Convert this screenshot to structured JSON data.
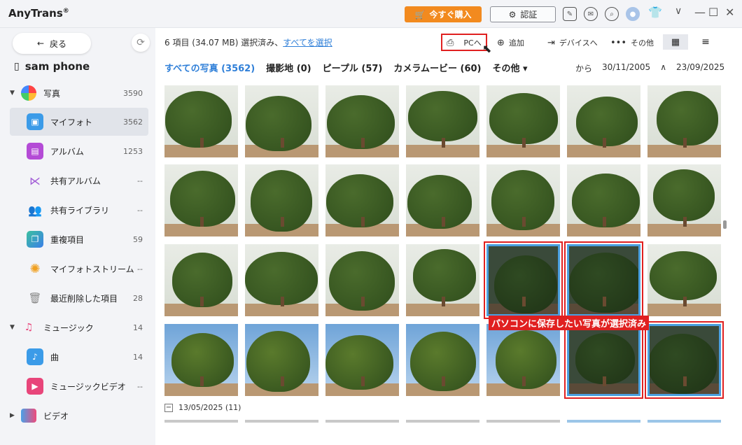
{
  "app": {
    "title": "AnyTrans",
    "reg": "®"
  },
  "titlebar": {
    "buy": "今すぐ購入",
    "auth": "認証"
  },
  "sidebar": {
    "back": "戻る",
    "device": "sam phone",
    "photos_group": {
      "label": "写真",
      "count": "3590"
    },
    "items": [
      {
        "label": "マイフォト",
        "count": "3562"
      },
      {
        "label": "アルバム",
        "count": "1253"
      },
      {
        "label": "共有アルバム",
        "count": "--"
      },
      {
        "label": "共有ライブラリ",
        "count": "--"
      },
      {
        "label": "重複項目",
        "count": "59"
      },
      {
        "label": "マイフォトストリーム",
        "count": "--"
      },
      {
        "label": "最近削除した項目",
        "count": "28"
      }
    ],
    "music_group": {
      "label": "ミュージック",
      "count": "14"
    },
    "music_items": [
      {
        "label": "曲",
        "count": "14"
      },
      {
        "label": "ミュージックビデオ",
        "count": "--"
      }
    ],
    "video_group": {
      "label": "ビデオ"
    }
  },
  "main": {
    "selection_text": "6 項目 (34.07 MB) 選択済み、",
    "select_all": "すべてを選択",
    "actions": {
      "to_pc": "PCへ",
      "add": "追加",
      "to_device": "デバイスへ",
      "more": "その他"
    },
    "tabs": [
      {
        "label": "すべての写真 (3562)"
      },
      {
        "label": "撮影地 (0)"
      },
      {
        "label": "ピープル (57)"
      },
      {
        "label": "カメラムービー (60)"
      },
      {
        "label": "その他 ▾"
      }
    ],
    "date_from_label": "から",
    "date_from": "30/11/2005",
    "date_sep": "∧",
    "date_to": "23/09/2025",
    "annotation": "パソコンに保存したい写真が選択済み",
    "section_date": "13/05/2025 (11)"
  }
}
